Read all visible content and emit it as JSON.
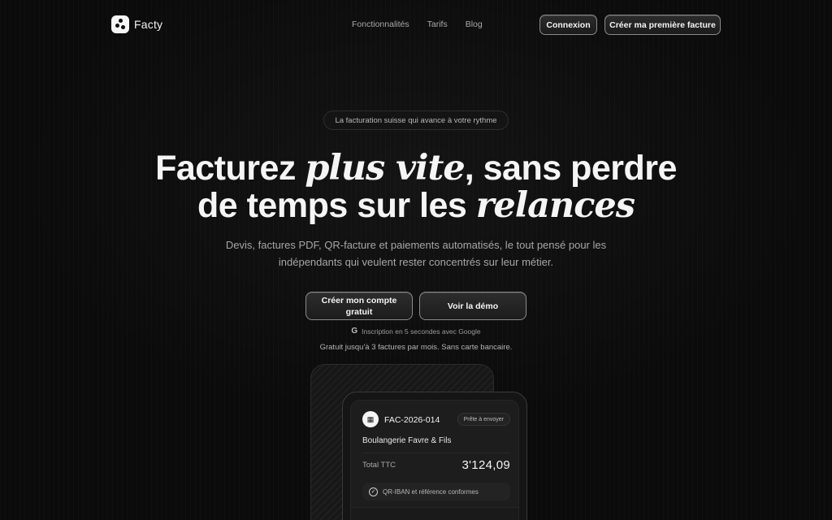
{
  "brand": {
    "name": "Facty"
  },
  "nav": {
    "links": [
      "Fonctionnalités",
      "Tarifs",
      "Blog"
    ],
    "login_label": "Connexion",
    "cta_label": "Créer ma première facture"
  },
  "hero": {
    "pill": "La facturation suisse qui avance à votre rythme",
    "headline": {
      "part1": "Facturez ",
      "italic1": "plus vite",
      "part2": ", sans perdre",
      "part3": "de temps sur les ",
      "italic2": "relances"
    },
    "subtitle": "Devis, factures PDF, QR-facture et paiements automatisés, le tout pensé pour les indépendants qui veulent rester concentrés sur leur métier.",
    "cta_primary": "Créer mon compte gratuit",
    "cta_secondary": "Voir la démo",
    "google_note": "Inscription en 5 secondes avec Google",
    "free_note": "Gratuit jusqu'à 3 factures par mois. Sans carte bancaire."
  },
  "invoice": {
    "number": "FAC-2026-014",
    "status": "Prête à envoyer",
    "client": "Boulangerie Favre & Fils",
    "total_label": "Total TTC",
    "total_value": "3'124,09",
    "check_text": "QR-IBAN et référence conformes"
  },
  "icons": {
    "logo": "facty-logo-icon",
    "google": "google-icon",
    "qr": "qr-icon",
    "check": "check-circle-icon"
  }
}
